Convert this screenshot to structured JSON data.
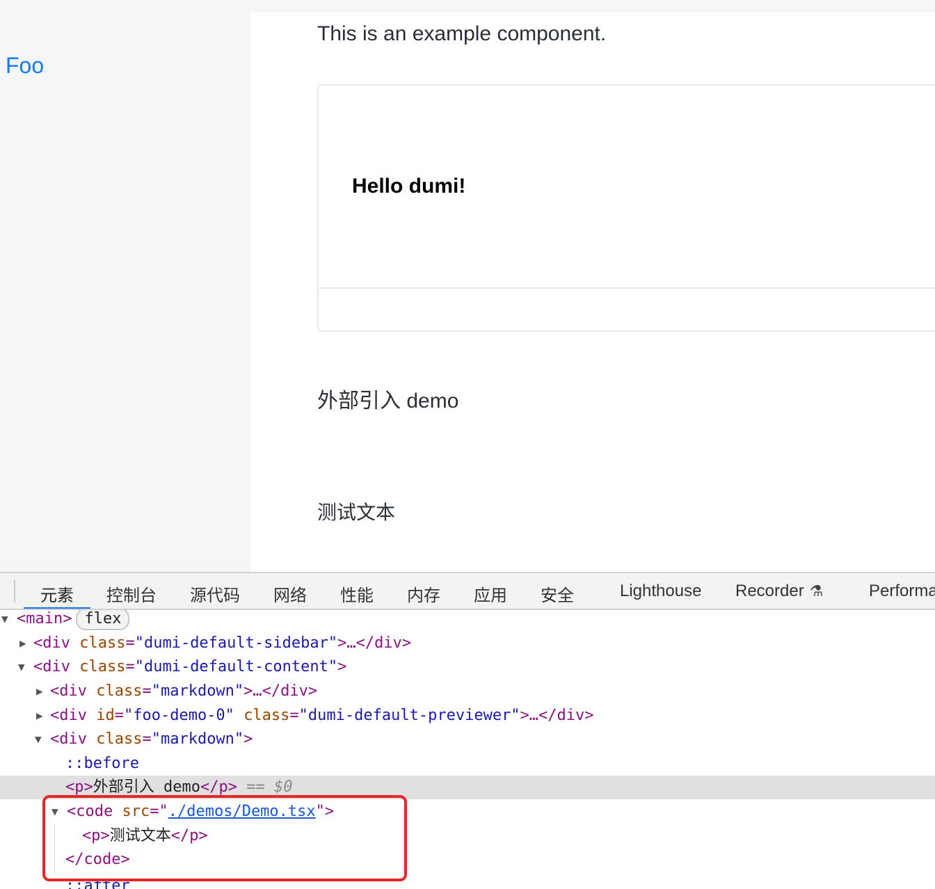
{
  "sidebar": {
    "link_label": "Foo"
  },
  "content": {
    "intro": "This is an example component.",
    "preview_text": "Hello dumi!",
    "external_heading": "外部引入 demo",
    "test_text": "测试文本"
  },
  "devtools": {
    "tabs": [
      "元素",
      "控制台",
      "源代码",
      "网络",
      "性能",
      "内存",
      "应用",
      "安全",
      "Lighthouse",
      "Recorder",
      "Performa"
    ],
    "active_tab": "元素",
    "elements": {
      "main_tag": "<main>",
      "main_badge": "flex",
      "sidebar_open": "<div ",
      "class_attr": "class",
      "eq": "=",
      "sidebar_class": "\"dumi-default-sidebar\"",
      "collapsed_close": ">…</div>",
      "content_class": "\"dumi-default-content\"",
      "close_gt": ">",
      "markdown_class": "\"markdown\"",
      "id_attr": "id",
      "demo_id": "\"foo-demo-0\"",
      "previewer_class": "\"dumi-default-previewer\"",
      "before": "::before",
      "p_open": "<p>",
      "p_text": "外部引入 demo",
      "p_close": "</p>",
      "selected_marker": "== $0",
      "code_open": "<code ",
      "src_attr": "src",
      "quote": "\"",
      "code_src": "./demos/Demo.tsx",
      "inner_p_text": "测试文本",
      "code_close": "</code>",
      "after": "::after"
    }
  },
  "colors": {
    "link": "#1677ff",
    "highlight_border": "#e8262a",
    "devtools_accent": "#1a73e8"
  }
}
